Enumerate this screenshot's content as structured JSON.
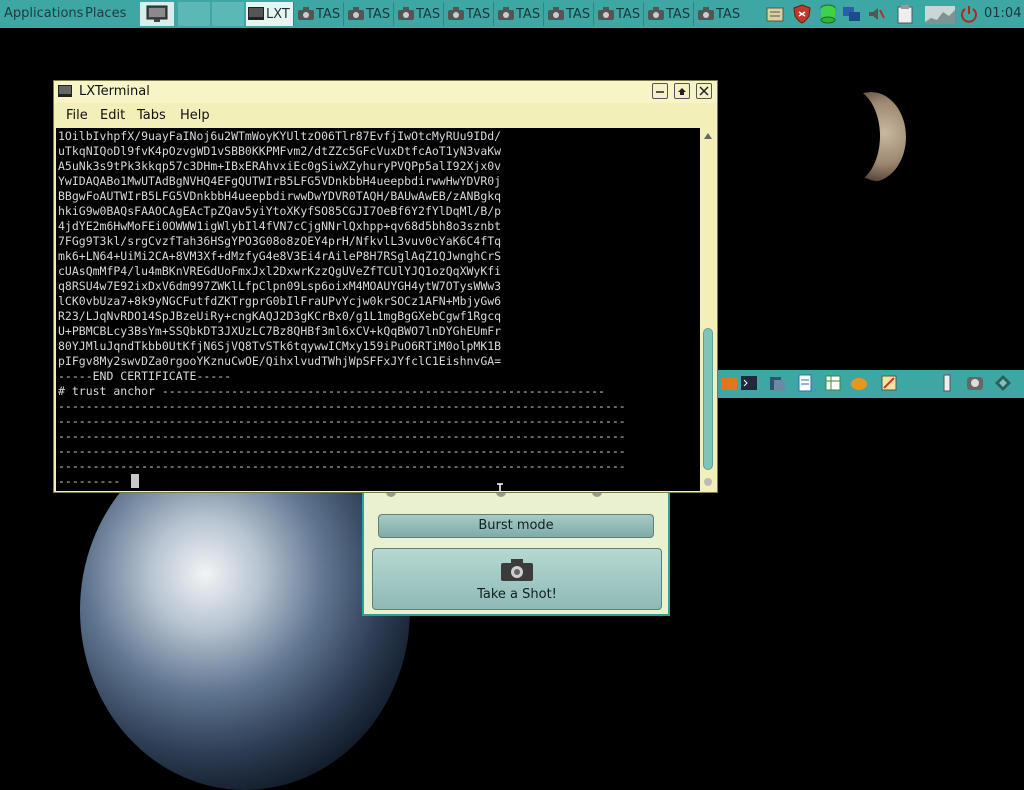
{
  "top_panel": {
    "applications": "Applications",
    "places": "Places",
    "tasks": [
      {
        "label": "LXT",
        "icon": "terminal-icon"
      },
      {
        "label": "TAS",
        "icon": "camera-icon"
      },
      {
        "label": "TAS",
        "icon": "camera-icon"
      },
      {
        "label": "TAS",
        "icon": "camera-icon"
      },
      {
        "label": "TAS",
        "icon": "camera-icon"
      },
      {
        "label": "TAS",
        "icon": "camera-icon"
      },
      {
        "label": "TAS",
        "icon": "camera-icon"
      },
      {
        "label": "TAS",
        "icon": "camera-icon"
      },
      {
        "label": "TAS",
        "icon": "camera-icon"
      }
    ],
    "tray": [
      "notes-icon",
      "shield-icon",
      "database-icon",
      "network-icon",
      "volume-icon",
      "clipboard-icon",
      "graph-icon",
      "power-icon"
    ],
    "clock": "01:04"
  },
  "terminal": {
    "title": "LXTerminal",
    "menu": [
      "File",
      "Edit",
      "Tabs",
      "Help"
    ],
    "lines": [
      "1OilbIvhpfX/9uayFaINoj6u2WTmWoyKYUltzO06Tlr87EvfjIwOtcMyRUu9IDd/",
      "uTkqNIQoDl9fvK4pOzvgWD1vSBB0KKPMFvm2/dtZZc5GFcVuxDtfcAoT1yN3vaKw",
      "A5uNk3s9tPk3kkqp57c3DHm+IBxERAhvxiEc0gSiwXZyhuryPVQPp5alI92Xjx0v",
      "YwIDAQABo1MwUTAdBgNVHQ4EFgQUTWIrB5LFG5VDnkbbH4ueepbdirwwHwYDVR0j",
      "BBgwFoAUTWIrB5LFG5VDnkbbH4ueepbdirwwDwYDVR0TAQH/BAUwAwEB/zANBgkq",
      "hkiG9w0BAQsFAAOCAgEAcTpZQav5yiYtoXKyfSO85CGJI7OeBf6Y2fYlDqMl/B/p",
      "4jdYE2m6HwMoFEi0OWWW1igWlybIl4fVN7cCjgNNrlQxhpp+qv68d5bh8o3sznbt",
      "7FGg9T3kl/srgCvzfTah36HSgYPO3G08o8zOEY4prH/NfkvlL3vuv0cYaK6C4fTq",
      "mk6+LN64+UiMi2CA+8VM3Xf+dMzfyG4e8V3Ei4rAileP8H7RSglAqZ1QJwnghCrS",
      "cUAsQmMfP4/lu4mBKnVREGdUoFmxJxl2DxwrKzzQgUVeZfTCUlYJQ1ozQqXWyKfi",
      "q8RSU4w7E92ixDxV6dm997ZWKlLfpClpn09Lsp6oixM4MOAUYGH4ytW7OTysWWw3",
      "lCK0vbUza7+8k9yNGCFutfdZKTrgprG0bIlFraUPvYcjw0krSOCz1AFN+MbjyGw6",
      "R23/LJqNvRDO14SpJBzeUiRy+cngKAQJ2D3gKCrBx0/g1L1mgBgGXebCgwf1Rgcq",
      "U+PBMCBLcy3BsYm+SSQbkDT3JXUzLC7Bz8QHBf3ml6xCV+kQqBWO7lnDYGhEUmFr",
      "80YJMluJqndTkbb0UtKfjN6SjVQ8TvSTk6tqywwICMxy159iPuO6RTiM0olpMK1B",
      "pIFgv8My2swvDZa0rgooYKznuCwOE/QihxlvudTWhjWpSFFxJYfclC1EishnvGA=",
      "-----END CERTIFICATE-----",
      "# trust anchor ----------------------------------------------------------------",
      "----------------------------------------------------------------------------------",
      "----------------------------------------------------------------------------------",
      "----------------------------------------------------------------------------------",
      "----------------------------------------------------------------------------------",
      "----------------------------------------------------------------------------------",
      "---------"
    ]
  },
  "camera_app": {
    "burst_label": "Burst mode",
    "shot_label": "Take a Shot!"
  },
  "dock": {
    "icons": [
      "folder-icon",
      "terminal-icon",
      "files-icon",
      "document-icon",
      "spreadsheet-icon",
      "paint-icon",
      "editor-icon",
      "tools-icon",
      "camera-icon",
      "network-icon"
    ]
  },
  "colors": {
    "panel": "#3fa7a3",
    "window_chrome": "#f2efb8",
    "terminal_bg": "#000000",
    "terminal_fg": "#d8d8d8"
  }
}
